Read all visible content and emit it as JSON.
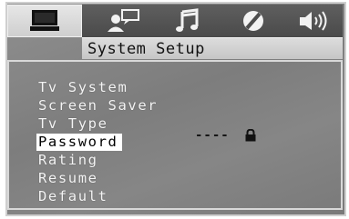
{
  "tabs": [
    {
      "name": "monitor-icon",
      "active": true
    },
    {
      "name": "person-chat-icon",
      "active": false
    },
    {
      "name": "music-note-icon",
      "active": false
    },
    {
      "name": "disc-icon",
      "active": false
    },
    {
      "name": "speaker-icon",
      "active": false
    }
  ],
  "title": "System Setup",
  "menu": {
    "items": [
      "Tv System",
      "Screen Saver",
      "Tv Type",
      "Password",
      "Rating",
      "Resume",
      "Default"
    ],
    "selected": "Password"
  },
  "password": {
    "value": "----",
    "lock_icon": "padlock-icon"
  },
  "colors": {
    "background": "#838383",
    "selected_bg": "#ffffff",
    "text": "#f4f4f4",
    "tab_active": "#dcdcdc"
  }
}
